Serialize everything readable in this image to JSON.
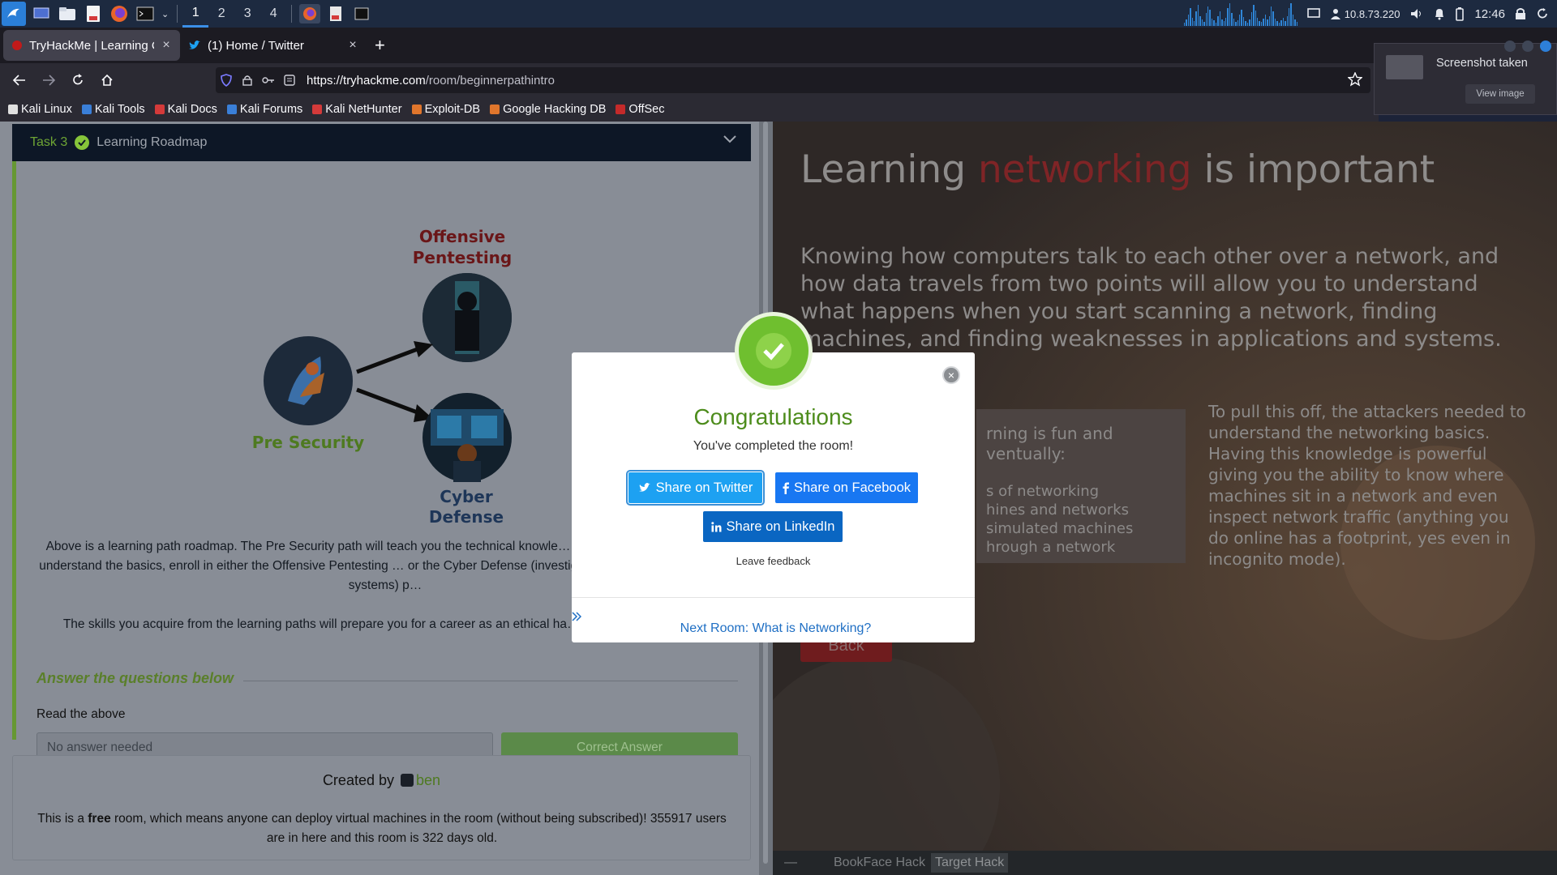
{
  "taskbar": {
    "workspaces": [
      "1",
      "2",
      "3",
      "4"
    ],
    "ip": "10.8.73.220",
    "time": "12:46",
    "icons": [
      "kali-menu-icon",
      "desktop-icon",
      "file-manager-icon",
      "text-editor-icon",
      "firefox-icon",
      "terminal-icon"
    ]
  },
  "tabs": [
    {
      "title": "TryHackMe | Learning Cyb",
      "close": "×"
    },
    {
      "title": "(1) Home / Twitter",
      "close": "×"
    }
  ],
  "new_tab": "+",
  "url": {
    "domain": "https://tryhackme.com",
    "path": "/room/beginnerpathintro"
  },
  "bookmarks": [
    "Kali Linux",
    "Kali Tools",
    "Kali Docs",
    "Kali Forums",
    "Kali NetHunter",
    "Exploit-DB",
    "Google Hacking DB",
    "OffSec"
  ],
  "bookmark_colors": [
    "#e0e0e0",
    "#3a7fd8",
    "#d43a3a",
    "#3a7fd8",
    "#d43a3a",
    "#e0762c",
    "#e0762c",
    "#c42a2a"
  ],
  "notification": {
    "title": "Screenshot taken",
    "button": "View image"
  },
  "task": {
    "number": "Task 3",
    "title": "Learning Roadmap",
    "roadmap": {
      "offensive": "Offensive Pentesting",
      "pre_security": "Pre Security",
      "cyber_defense": "Cyber Defense"
    },
    "para1": "Above is a learning path roadmap. The Pre Security path will teach you the technical knowle… in cyber security. Once you understand the basics, enroll in either the Offensive Pentesting … or the Cyber Defense (investigating attacks and defending systems) p…",
    "para2": "The skills you acquire from the learning paths will prepare you for a career as an ethical ha… cyber security analyst.",
    "questions_title": "Answer the questions below",
    "question": "Read the above",
    "answer_placeholder": "No answer needed",
    "answer_button": "Correct Answer"
  },
  "created": {
    "prefix": "Created by",
    "user": "ben",
    "free_text_1": "This is a ",
    "free_word": "free",
    "free_text_2": " room, which means anyone can deploy virtual machines in the room (without being subscribed)! 355917 users are in here and this room is 322 days old."
  },
  "right": {
    "heading_1": "Learning ",
    "heading_red": "networking",
    "heading_2": " is important",
    "paragraph": "Knowing how computers talk to each other over a network, and how data travels from two points will allow you to understand what happens when you start scanning a network, finding machines, and finding weaknesses in applications and systems.",
    "box_line_1": "rning is fun and",
    "box_line_2": "ventually:",
    "box_list": [
      "s of networking",
      "hines and networks",
      " simulated machines",
      "hrough a network"
    ],
    "side_paragraph": "To pull this off, the attackers needed to understand the networking basics. Having this knowledge is powerful giving you the ability to know where machines sit in a network and even inspect network traffic (anything you do online has a footprint, yes even in incognito mode).",
    "back_button": "Back",
    "bottom_minus": "—",
    "bottom_tabs": [
      "BookFace Hack",
      "Target Hack"
    ]
  },
  "modal": {
    "title": "Congratulations",
    "subtitle": "You've completed the room!",
    "twitter": "Share on Twitter",
    "facebook": "Share on Facebook",
    "linkedin": "Share on LinkedIn",
    "feedback": "Leave feedback",
    "next_room": "Next Room: What is Networking?",
    "close": "×"
  }
}
